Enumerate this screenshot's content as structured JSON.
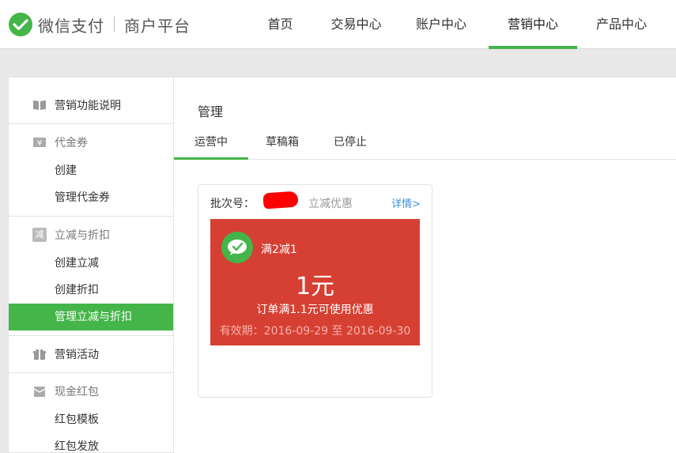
{
  "header": {
    "brand_name": "微信支付",
    "brand_sub": "商户平台",
    "nav": [
      {
        "label": "首页",
        "active": false
      },
      {
        "label": "交易中心",
        "active": false
      },
      {
        "label": "账户中心",
        "active": false
      },
      {
        "label": "营销中心",
        "active": true
      },
      {
        "label": "产品中心",
        "active": false
      }
    ],
    "accent": "#44b549"
  },
  "sidebar": {
    "intro": {
      "label": "营销功能说明",
      "icon": "book-icon"
    },
    "coupon": {
      "label": "代金券",
      "icon": "yen-icon",
      "items": [
        "创建",
        "管理代金券"
      ]
    },
    "discount": {
      "label": "立减与折扣",
      "icon": "reduce-icon",
      "icon_text": "减",
      "items": [
        "创建立减",
        "创建折扣",
        "管理立减与折扣"
      ],
      "active_item": "管理立减与折扣"
    },
    "activity": {
      "label": "营销活动",
      "icon": "gift-icon"
    },
    "redpack": {
      "label": "现金红包",
      "icon": "redpacket-icon",
      "items": [
        "红包模板",
        "红包发放"
      ]
    }
  },
  "main": {
    "title": "管理",
    "tabs": [
      "运营中",
      "草稿箱",
      "已停止"
    ],
    "active_tab": "运营中",
    "card": {
      "batch_label": "批次号：",
      "type_label": "立减优惠",
      "detail_link": "详情>",
      "coupon": {
        "name": "满2减1",
        "amount": "1元",
        "condition": "订单满1.1元可使用优惠",
        "validity": "有效期：2016-09-29 至 2016-09-30",
        "color": "#d64033"
      }
    }
  }
}
